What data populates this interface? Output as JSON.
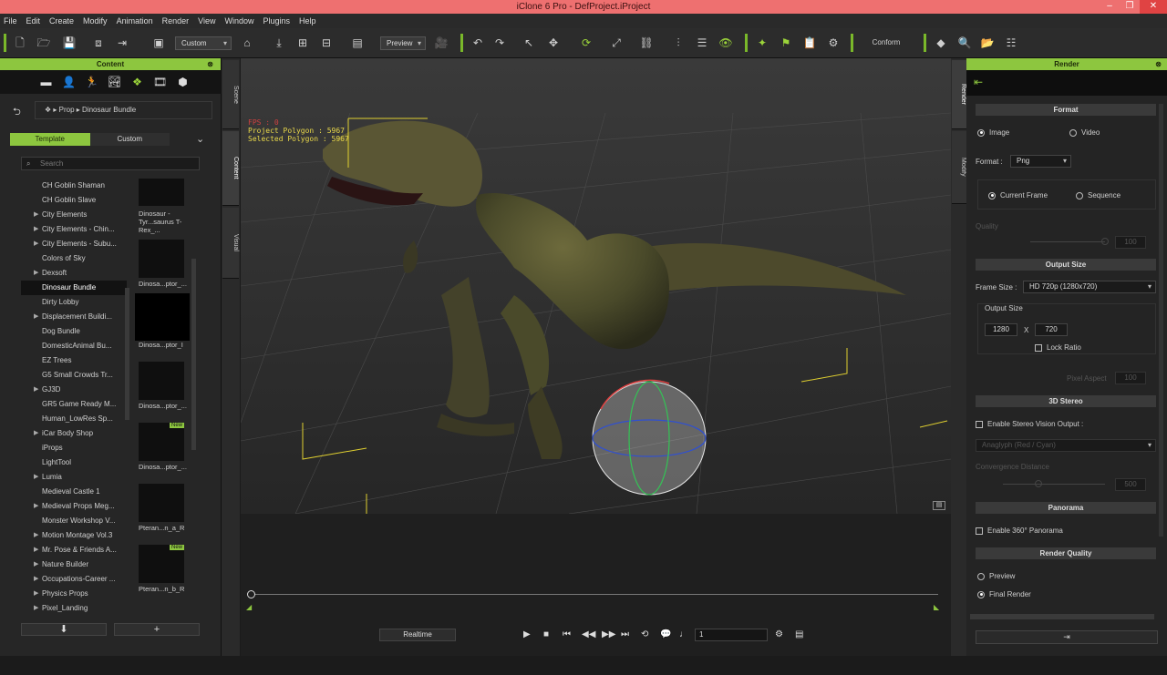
{
  "window": {
    "title": "iClone 6 Pro - DefProject.iProject",
    "min": "–",
    "max": "❐",
    "close": "✕"
  },
  "menu": [
    "File",
    "Edit",
    "Create",
    "Modify",
    "Animation",
    "Render",
    "View",
    "Window",
    "Plugins",
    "Help"
  ],
  "toolbar": {
    "preset": "Custom",
    "view_mode": "Preview",
    "conform": "Conform"
  },
  "content_panel": {
    "title": "Content",
    "breadcrumb": [
      "Prop",
      "Dinosaur Bundle"
    ],
    "tabs": {
      "template": "Template",
      "custom": "Custom"
    },
    "search_placeholder": "Search",
    "tree": [
      {
        "label": "CH Goblin Shaman",
        "expandable": false
      },
      {
        "label": "CH Goblin Slave",
        "expandable": false
      },
      {
        "label": "City Elements",
        "expandable": true
      },
      {
        "label": "City Elements - Chin...",
        "expandable": true
      },
      {
        "label": "City Elements - Subu...",
        "expandable": true
      },
      {
        "label": "Colors of Sky",
        "expandable": false
      },
      {
        "label": "Dexsoft",
        "expandable": true
      },
      {
        "label": "Dinosaur Bundle",
        "expandable": false,
        "selected": true
      },
      {
        "label": "Dirty Lobby",
        "expandable": false
      },
      {
        "label": "Displacement Buildi...",
        "expandable": true
      },
      {
        "label": "Dog Bundle",
        "expandable": false
      },
      {
        "label": "DomesticAnimal Bu...",
        "expandable": false
      },
      {
        "label": "EZ Trees",
        "expandable": false
      },
      {
        "label": "G5 Small Crowds Tr...",
        "expandable": false
      },
      {
        "label": "GJ3D",
        "expandable": true
      },
      {
        "label": "GR5 Game Ready M...",
        "expandable": false
      },
      {
        "label": "Human_LowRes Sp...",
        "expandable": false
      },
      {
        "label": "iCar Body Shop",
        "expandable": true
      },
      {
        "label": "iProps",
        "expandable": false
      },
      {
        "label": "LightTool",
        "expandable": false
      },
      {
        "label": "Lumia",
        "expandable": true
      },
      {
        "label": "Medieval Castle 1",
        "expandable": false
      },
      {
        "label": "Medieval Props Meg...",
        "expandable": true
      },
      {
        "label": "Monster Workshop V...",
        "expandable": false
      },
      {
        "label": "Motion Montage Vol.3",
        "expandable": true
      },
      {
        "label": "Mr. Pose & Friends A...",
        "expandable": true
      },
      {
        "label": "Nature Builder",
        "expandable": true
      },
      {
        "label": "Occupations-Career ...",
        "expandable": true
      },
      {
        "label": "Physics Props",
        "expandable": true
      },
      {
        "label": "Pixel_Landing",
        "expandable": true
      }
    ],
    "thumbnails": [
      {
        "caption": "Dinosaur - Tyr...saurus T-Rex_...",
        "new": false
      },
      {
        "caption": "Dinosa...ptor_...",
        "new": false
      },
      {
        "caption": "Dinosa...ptor_I",
        "new": false,
        "selected": true
      },
      {
        "caption": "Dinosa...ptor_...",
        "new": false
      },
      {
        "caption": "Dinosa...ptor_...",
        "new": true
      },
      {
        "caption": "Pteran...n_a_R",
        "new": false
      },
      {
        "caption": "Pteran...n_b_R",
        "new": true
      }
    ],
    "new_badge": "New",
    "down_btn": "⬇",
    "add_btn": "+"
  },
  "side_tabs": [
    "Scene",
    "Content",
    "Visual"
  ],
  "viewport": {
    "fps": "FPS : 0",
    "project_polygon": "Project Polygon : 5967",
    "selected_polygon": "Selected Polygon : 5967"
  },
  "timeline": {
    "realtime": "Realtime",
    "frame": "1"
  },
  "render_panel": {
    "side_tabs": [
      "Render",
      "Modify"
    ],
    "title": "Render",
    "format_section": "Format",
    "image": "Image",
    "video": "Video",
    "format_label": "Format :",
    "format_value": "Png",
    "current_frame": "Current Frame",
    "sequence": "Sequence",
    "quality": "Quality",
    "quality_value": "100",
    "output_size_section": "Output Size",
    "frame_size_label": "Frame Size :",
    "frame_size_value": "HD 720p (1280x720)",
    "output_size_label": "Output Size",
    "width": "1280",
    "x": "X",
    "height": "720",
    "lock_ratio": "Lock Ratio",
    "pixel_aspect": "Pixel Aspect",
    "pixel_aspect_value": "100",
    "stereo_section": "3D Stereo",
    "enable_stereo": "Enable Stereo Vision Output :",
    "anaglyph": "Anaglyph (Red / Cyan)",
    "convergence": "Convergence Distance",
    "convergence_value": "500",
    "panorama_section": "Panorama",
    "enable_panorama": "Enable 360° Panorama",
    "quality_section": "Render Quality",
    "preview": "Preview",
    "final_render": "Final Render"
  }
}
